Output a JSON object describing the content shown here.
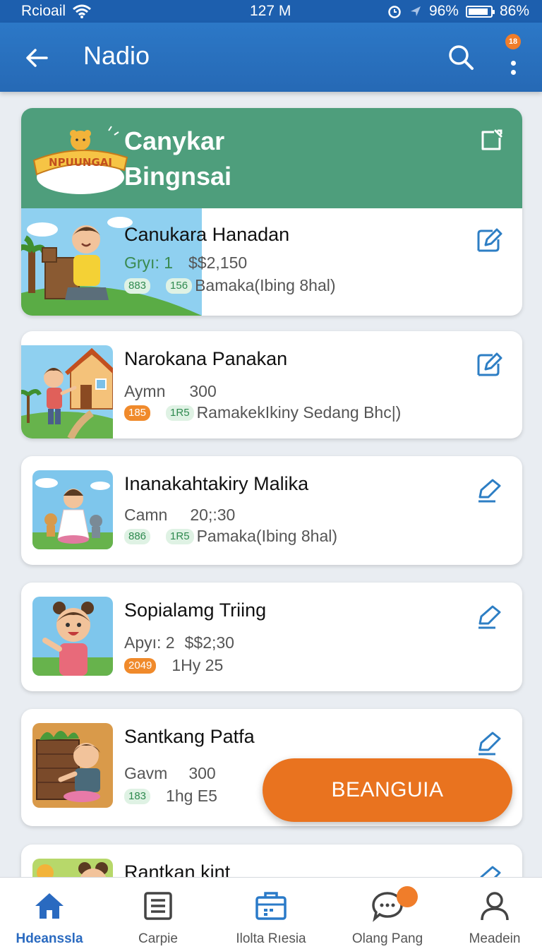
{
  "status_bar": {
    "carrier": "Rcioail",
    "time": "127 M",
    "battery_pct": "96%",
    "right_text": "86%"
  },
  "app_bar": {
    "title": "Nadio",
    "badge": "18"
  },
  "featured": {
    "logo_text": "NPUUNGAI",
    "title_line1": "Canykar",
    "title_line2": "Bingnsai",
    "item": {
      "title": "Canukara Hanadan",
      "label": "Gryı: 1",
      "price": "$$2,150",
      "pill": "883",
      "pill2": "156",
      "desc": "Bamaka(Ibing 8hal)"
    }
  },
  "items": [
    {
      "title": "Narokana Panakan",
      "label": "Aymn",
      "value": "300",
      "pill": "185",
      "pill_color": "orange",
      "pill2": "1R5",
      "desc": "RamakekIkiny Sedang Bhc|)"
    },
    {
      "title": "Inanakahtakiry Malika",
      "label": "Camn",
      "value": "20;:30",
      "pill": "886",
      "pill_color": "green",
      "pill2": "1R5",
      "desc": "Pamaka(Ibing 8hal)"
    },
    {
      "title": "Sopialamg Triing",
      "label": "Apyı: 2",
      "value": "$$2;30",
      "pill": "2049",
      "pill_color": "orange",
      "pill2": "",
      "desc": "1Hy 25"
    },
    {
      "title": "Santkang Patfa",
      "label": "Gavm",
      "value": "300",
      "pill": "183",
      "pill_color": "green",
      "pill2": "",
      "desc": "1hg E5"
    },
    {
      "title": "Rantkan kint"
    }
  ],
  "fab": {
    "label": "BEANGUIA"
  },
  "bottom_nav": [
    {
      "label": "Hdeanssla",
      "icon": "home-icon",
      "active": true
    },
    {
      "label": "Carpie",
      "icon": "document-icon",
      "active": false
    },
    {
      "label": "Ilolta Rıesia",
      "icon": "calendar-icon",
      "active": false
    },
    {
      "label": "Olang Pang",
      "icon": "chat-icon",
      "active": false
    },
    {
      "label": "Meadein",
      "icon": "profile-icon",
      "active": false
    }
  ],
  "colors": {
    "primary": "#2669b5",
    "featured": "#4e9e7c",
    "accent": "#e9731f"
  }
}
